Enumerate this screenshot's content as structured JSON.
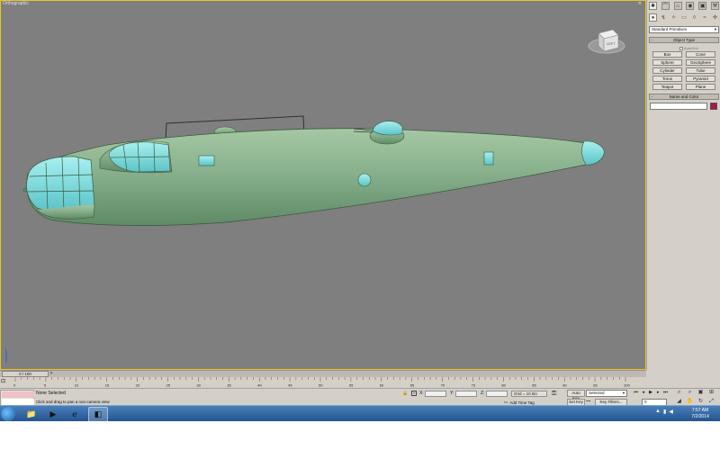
{
  "viewport": {
    "label": "Orthographic",
    "viewcube_label": "LEFT"
  },
  "command_panel": {
    "category": "Standard Primitives",
    "object_type_title": "Object Type",
    "autogrid_label": "AutoGrid",
    "primitives": [
      "Box",
      "Cone",
      "Sphere",
      "GeoSphere",
      "Cylinder",
      "Tube",
      "Torus",
      "Pyramid",
      "Teapot",
      "Plane"
    ],
    "name_color_title": "Name and Color",
    "name_value": "",
    "object_color": "#a8184c"
  },
  "time_slider": {
    "frame_indicator": "0 / 100",
    "next_arrow": ">",
    "ticks": [
      "0",
      "5",
      "10",
      "15",
      "20",
      "25",
      "30",
      "35",
      "40",
      "45",
      "50",
      "55",
      "60",
      "65",
      "70",
      "75",
      "80",
      "85",
      "90",
      "95",
      "100"
    ]
  },
  "status": {
    "selection": "None Selected",
    "prompt": "Click and drag to pan a non-camera view",
    "x_label": "X:",
    "y_label": "Y:",
    "z_label": "Z:",
    "grid": "Grid = 10.0in",
    "add_time_tag": "Add Time Tag",
    "auto_key": "Auto Key",
    "set_key": "Set Key",
    "selected_dropdown": "Selected",
    "key_filters": "Key Filters...",
    "current_frame": "0"
  },
  "taskbar": {
    "time": "7:57 AM",
    "date": "7/2/2014"
  },
  "colors": {
    "viewport_bg": "#7f7f7f",
    "fuselage": "#88b08c",
    "glass": "#7fd8d8",
    "active_border": "#e8c62a"
  }
}
